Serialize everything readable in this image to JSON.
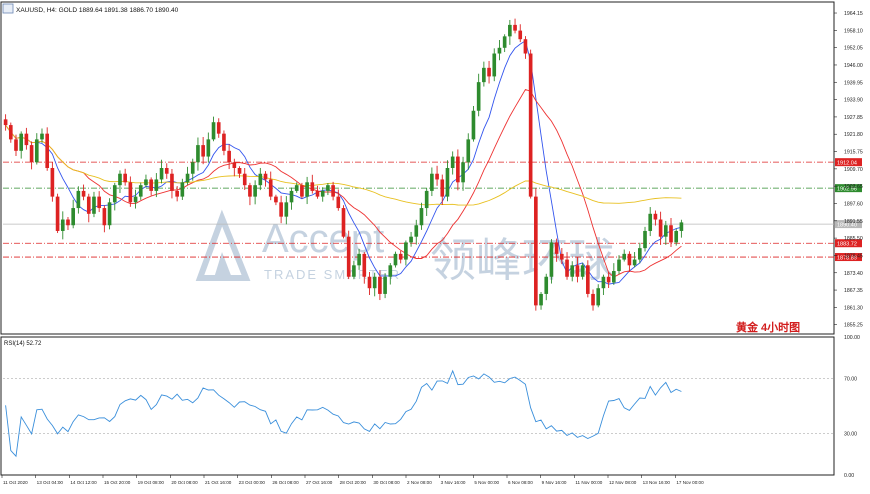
{
  "header": {
    "icon": "chart-window-icon",
    "title": "XAUUSD, H4:  GOLD  1889.64 1891.38 1886.70 1890.40"
  },
  "watermark": {
    "brand": "Accept",
    "subtitle": "TRADE SMARTER",
    "chinese": "领峰环球"
  },
  "annotation": "黄金  4小时图",
  "colors": {
    "bull": "#2e8b2e",
    "bear": "#dd2222",
    "ma_fast": "#3355ee",
    "ma_mid": "#ee3333",
    "ma_slow": "#e8c020",
    "rsi": "#3a8fdb",
    "watermark": "#c5d2e0"
  },
  "chart_data": [
    {
      "type": "candlestick",
      "symbol": "XAUUSD",
      "timeframe": "H4",
      "ylim": [
        1852.0,
        1968.0
      ],
      "y_ticks": [
        "1964.15",
        "1958.10",
        "1952.05",
        "1946.00",
        "1939.95",
        "1933.90",
        "1927.85",
        "1921.80",
        "1915.75",
        "1909.70",
        "1903.65",
        "1897.60",
        "1891.55",
        "1885.50",
        "1879.45",
        "1873.40",
        "1867.35",
        "1861.30",
        "1855.25"
      ],
      "x_ticks": [
        "11 Oct 2020",
        "13 Oct 04:00",
        "14 Oct 12:00",
        "15 Oct 20:00",
        "19 Oct 08:00",
        "20 Oct 08:00",
        "21 Oct 16:00",
        "23 Oct 00:00",
        "26 Oct 08:00",
        "27 Oct 16:00",
        "28 Oct 20:00",
        "30 Oct 08:00",
        "2 Nov 08:00",
        "3 Nov 16:00",
        "5 Nov 00:00",
        "6 Nov 08:00",
        "9 Nov 16:00",
        "11 Nov 00:00",
        "12 Nov 08:00",
        "13 Nov 16:00",
        "17 Nov 00:00"
      ],
      "price_levels": [
        {
          "value": "1912.04",
          "color": "#dd2222",
          "style": "dash-dot"
        },
        {
          "value": "1902.96",
          "color": "#2e8b2e",
          "style": "dash-dot"
        },
        {
          "value": "1890.40",
          "color": "#b8b8b8",
          "style": "solid"
        },
        {
          "value": "1883.72",
          "color": "#dd2222",
          "style": "dash-dot"
        },
        {
          "value": "1878.89",
          "color": "#dd2222",
          "style": "dash-dot"
        }
      ],
      "close_path": [
        1925,
        1920,
        1916,
        1922,
        1918,
        1912,
        1920,
        1922,
        1910,
        1900,
        1888,
        1892,
        1890,
        1896,
        1902,
        1900,
        1894,
        1900,
        1896,
        1890,
        1898,
        1904,
        1908,
        1905,
        1898,
        1900,
        1904,
        1906,
        1902,
        1906,
        1910,
        1908,
        1902,
        1900,
        1905,
        1908,
        1912,
        1918,
        1914,
        1920,
        1926,
        1922,
        1916,
        1912,
        1910,
        1908,
        1904,
        1900,
        1904,
        1908,
        1906,
        1900,
        1898,
        1893,
        1898,
        1902,
        1904,
        1900,
        1905,
        1902,
        1900,
        1902,
        1904,
        1900,
        1896,
        1886,
        1872,
        1876,
        1880,
        1872,
        1868,
        1872,
        1866,
        1872,
        1876,
        1880,
        1878,
        1884,
        1886,
        1890,
        1896,
        1902,
        1908,
        1906,
        1900,
        1910,
        1914,
        1905,
        1912,
        1920,
        1930,
        1940,
        1945,
        1942,
        1950,
        1952,
        1956,
        1960,
        1958,
        1955,
        1950,
        1900,
        1862,
        1866,
        1872,
        1884,
        1880,
        1878,
        1872,
        1876,
        1872,
        1876,
        1866,
        1862,
        1868,
        1872,
        1870,
        1874,
        1878,
        1880,
        1876,
        1878,
        1882,
        1888,
        1894,
        1892,
        1886,
        1890,
        1884,
        1888,
        1891
      ],
      "indicators": [
        {
          "name": "MA fast",
          "color_key": "ma_fast"
        },
        {
          "name": "MA mid",
          "color_key": "ma_mid"
        },
        {
          "name": "MA slow",
          "color_key": "ma_slow"
        }
      ]
    },
    {
      "type": "line",
      "label": "RSI(14) 52.72",
      "ylim": [
        0,
        100
      ],
      "y_ticks": [
        "100.00",
        "70.00",
        "30.00",
        "0.00"
      ],
      "levels": [
        70,
        30
      ]
    }
  ]
}
